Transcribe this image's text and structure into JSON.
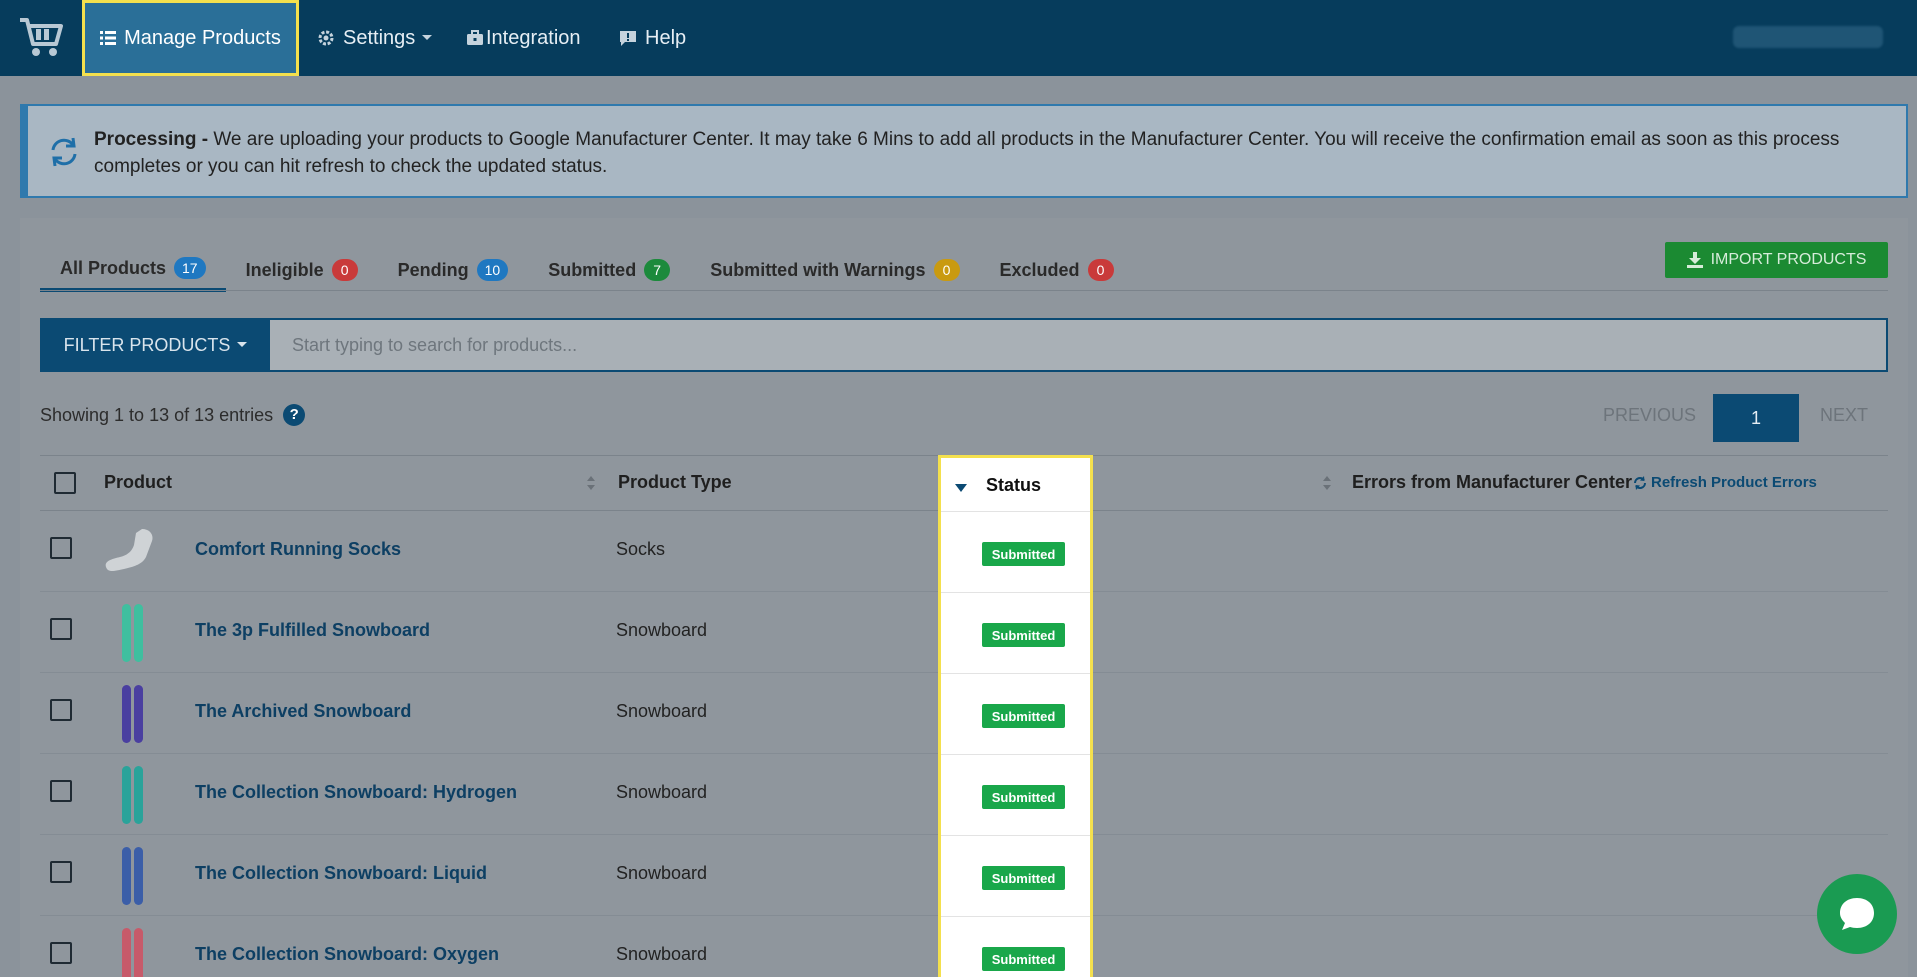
{
  "nav": {
    "manage_products": "Manage Products",
    "settings": "Settings",
    "integration": "Integration",
    "help": "Help"
  },
  "alert": {
    "label": "Processing -",
    "message": "We are uploading your products to Google Manufacturer Center. It may take 6 Mins to add all products in the Manufacturer Center. You will receive the confirmation email as soon as this process completes or you can hit refresh to check the updated status."
  },
  "tabs": [
    {
      "label": "All Products",
      "count": "17",
      "color": "#1f78c1"
    },
    {
      "label": "Ineligible",
      "count": "0",
      "color": "#c93a3a"
    },
    {
      "label": "Pending",
      "count": "10",
      "color": "#1f78c1"
    },
    {
      "label": "Submitted",
      "count": "7",
      "color": "#1c8a3c"
    },
    {
      "label": "Submitted with Warnings",
      "count": "0",
      "color": "#c99a10"
    },
    {
      "label": "Excluded",
      "count": "0",
      "color": "#c93a3a"
    }
  ],
  "import_button": "IMPORT PRODUCTS",
  "filter": {
    "button": "FILTER PRODUCTS",
    "placeholder": "Start typing to search for products..."
  },
  "entries_text": "Showing 1 to 13 of 13 entries",
  "help_mark": "?",
  "pagination": {
    "previous": "PREVIOUS",
    "current": "1",
    "next": "NEXT"
  },
  "table": {
    "headers": {
      "product": "Product",
      "product_type": "Product Type",
      "status": "Status",
      "errors": "Errors from Manufacturer Center",
      "refresh": "Refresh Product Errors"
    },
    "rows": [
      {
        "name": "Comfort Running Socks",
        "type": "Socks",
        "status": "Submitted",
        "thumb_color": "#cfd3d6"
      },
      {
        "name": "The 3p Fulfilled Snowboard",
        "type": "Snowboard",
        "status": "Submitted",
        "thumb_color": "#3fbf9f"
      },
      {
        "name": "The Archived Snowboard",
        "type": "Snowboard",
        "status": "Submitted",
        "thumb_color": "#4a3fa0"
      },
      {
        "name": "The Collection Snowboard: Hydrogen",
        "type": "Snowboard",
        "status": "Submitted",
        "thumb_color": "#2aa39a"
      },
      {
        "name": "The Collection Snowboard: Liquid",
        "type": "Snowboard",
        "status": "Submitted",
        "thumb_color": "#3b5ea8"
      },
      {
        "name": "The Collection Snowboard: Oxygen",
        "type": "Snowboard",
        "status": "Submitted",
        "thumb_color": "#c75a6a"
      }
    ]
  }
}
